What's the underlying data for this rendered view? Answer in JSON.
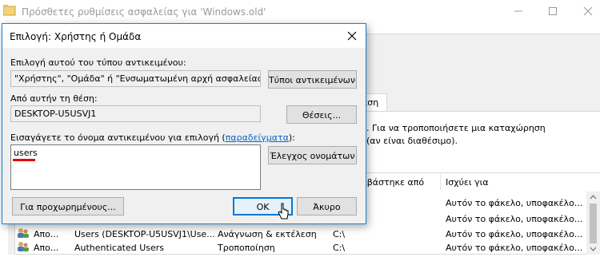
{
  "background_window": {
    "title": "Πρόσθετες ρυθμίσεις ασφαλείας για 'Windows.old'",
    "tab_label": "αση",
    "info_line1": ". Για να τροποποιήσετε μια καταχώρηση",
    "info_line2": "(αν είναι διαθέσιμο).",
    "columns": {
      "inherited_from": "ιβάστηκε από",
      "applies_to": "Ισχύει για"
    },
    "rows": [
      {
        "type": "",
        "principal": "",
        "access": "",
        "inherited": "",
        "applies": "Αυτόν το φάκελο, υποφακέλο..."
      },
      {
        "type": "",
        "principal": "",
        "access": "",
        "inherited": "",
        "applies": "Αυτόν το φάκελο, υποφακέλο..."
      },
      {
        "type": "Απο...",
        "principal": "Users (DESKTOP-U5USVJ1\\Use...",
        "access": "Ανάγνωση & εκτέλεση",
        "inherited": "C:\\",
        "applies": "Αυτόν το φάκελο, υποφακέλο..."
      },
      {
        "type": "Απο...",
        "principal": "Authenticated Users",
        "access": "Τροποποίηση",
        "inherited": "C:\\",
        "applies": "Αυτόν το φάκελο, υποφακέλο..."
      }
    ]
  },
  "dialog": {
    "title": "Επιλογή: Χρήστης ή Ομάδα",
    "object_type_label": "Επιλογή αυτού του τύπου αντικειμένου:",
    "object_type_value": "\"Χρήστης\", \"Ομάδα\" ή \"Ενσωματωμένη αρχή ασφαλείας\"",
    "object_types_button": "Τύποι αντικειμένων...",
    "location_label": "Από αυτήν τη θέση:",
    "location_value": "DESKTOP-U5USVJ1",
    "locations_button": "Θέσεις...",
    "enter_label_prefix": "Εισαγάγετε το όνομα αντικειμένου για επιλογή (",
    "examples_link": "παραδείγματα",
    "enter_label_suffix": "):",
    "object_name_value": "users",
    "check_names_button": "Έλεγχος ονομάτων",
    "advanced_button": "Για προχωρημένους...",
    "ok_button": "OK",
    "cancel_button": "Άκυρο"
  },
  "colors": {
    "dialog_border": "#1883d7",
    "link": "#0066cc",
    "spell_underline": "#e00000",
    "default_button_border": "#0078d7"
  }
}
